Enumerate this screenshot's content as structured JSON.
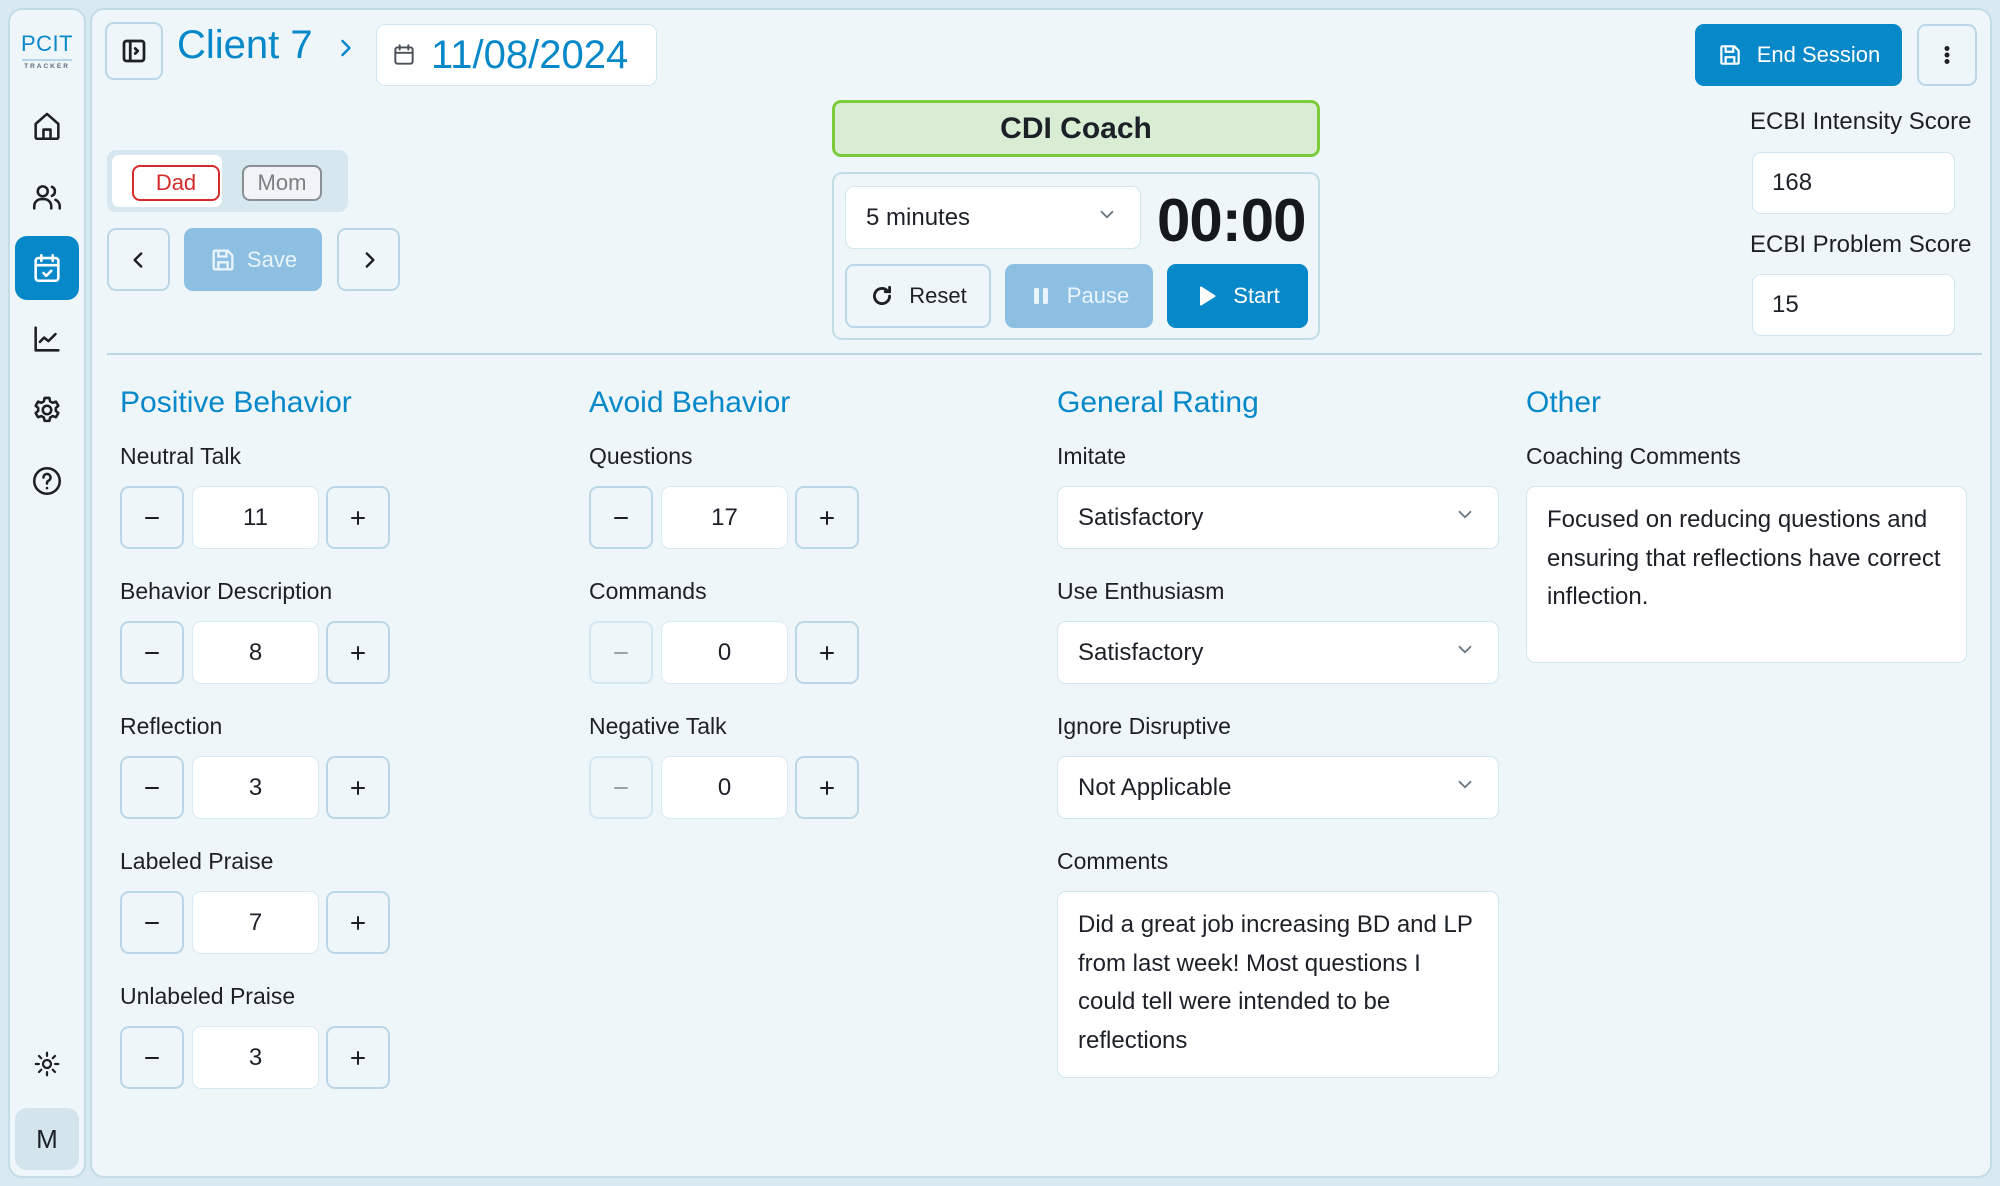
{
  "app": {
    "logo_main": "PCIT",
    "logo_sub": "TRACKER"
  },
  "sidebar": {
    "items": [
      {
        "label": "Home",
        "icon": "home-icon",
        "active": false
      },
      {
        "label": "Clients",
        "icon": "users-icon",
        "active": false
      },
      {
        "label": "Sessions",
        "icon": "calendar-check-icon",
        "active": true
      },
      {
        "label": "Progress",
        "icon": "chart-line-icon",
        "active": false
      },
      {
        "label": "Settings",
        "icon": "gear-icon",
        "active": false
      },
      {
        "label": "Help",
        "icon": "help-circle-icon",
        "active": false
      }
    ],
    "theme_icon": "sun-icon",
    "avatar_initial": "M"
  },
  "header": {
    "client_name": "Client 7",
    "date": "11/08/2024",
    "end_session_label": "End Session"
  },
  "parents": {
    "tabs": [
      {
        "label": "Dad",
        "selected": true,
        "color": "#d52b2b"
      },
      {
        "label": "Mom",
        "selected": false,
        "color": "#7a8088"
      }
    ]
  },
  "nav": {
    "save_label": "Save"
  },
  "mode": {
    "label": "CDI Coach",
    "color": "#7ccb3b"
  },
  "timer": {
    "duration": "5 minutes",
    "display": "00:00",
    "reset_label": "Reset",
    "pause_label": "Pause",
    "start_label": "Start"
  },
  "ecbi": {
    "intensity_label": "ECBI Intensity Score",
    "intensity_value": "168",
    "problem_label": "ECBI Problem Score",
    "problem_value": "15"
  },
  "positive_behavior": {
    "title": "Positive Behavior",
    "items": [
      {
        "label": "Neutral Talk",
        "value": "11"
      },
      {
        "label": "Behavior Description",
        "value": "8"
      },
      {
        "label": "Reflection",
        "value": "3"
      },
      {
        "label": "Labeled Praise",
        "value": "7"
      },
      {
        "label": "Unlabeled Praise",
        "value": "3"
      }
    ]
  },
  "avoid_behavior": {
    "title": "Avoid Behavior",
    "items": [
      {
        "label": "Questions",
        "value": "17"
      },
      {
        "label": "Commands",
        "value": "0"
      },
      {
        "label": "Negative Talk",
        "value": "0"
      }
    ]
  },
  "general_rating": {
    "title": "General Rating",
    "items": [
      {
        "label": "Imitate",
        "value": "Satisfactory"
      },
      {
        "label": "Use Enthusiasm",
        "value": "Satisfactory"
      },
      {
        "label": "Ignore Disruptive",
        "value": "Not Applicable"
      }
    ],
    "comments_label": "Comments",
    "comments_value": "Did a great job increasing BD and LP from last week! Most questions I could tell were intended to be reflections"
  },
  "other": {
    "title": "Other",
    "coaching_label": "Coaching Comments",
    "coaching_value": "Focused on reducing questions and ensuring that reflections have correct inflection."
  },
  "colors": {
    "accent": "#0788c9",
    "background": "#eef6fa",
    "disabled_button": "#8cbfe2"
  }
}
